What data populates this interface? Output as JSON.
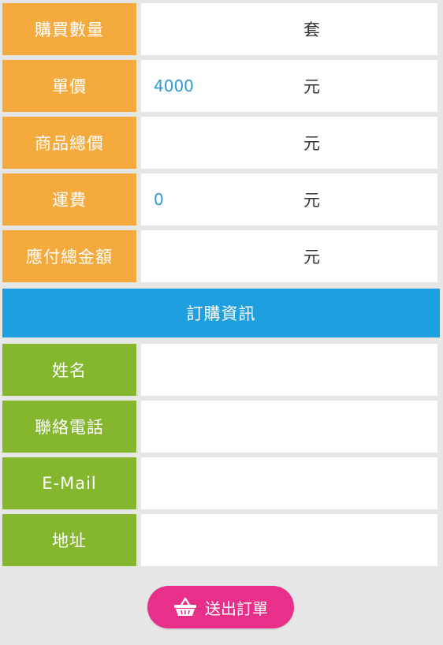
{
  "colors": {
    "order_label_bg": "#f4aa3c",
    "info_label_bg": "#84b72e",
    "section_bg": "#1ea0e0",
    "value_text": "#2b9bd3",
    "submit_bg": "#e8308a"
  },
  "order": {
    "quantity": {
      "label": "購買數量",
      "value": "",
      "unit": "套"
    },
    "unit_price": {
      "label": "單價",
      "value": "4000",
      "unit": "元"
    },
    "subtotal": {
      "label": "商品總價",
      "value": "",
      "unit": "元"
    },
    "shipping": {
      "label": "運費",
      "value": "0",
      "unit": "元"
    },
    "total": {
      "label": "應付總金額",
      "value": "",
      "unit": "元"
    }
  },
  "section_title": "訂購資訊",
  "customer": {
    "name": {
      "label": "姓名",
      "value": ""
    },
    "phone": {
      "label": "聯絡電話",
      "value": ""
    },
    "email": {
      "label": "E-Mail",
      "value": ""
    },
    "address": {
      "label": "地址",
      "value": ""
    }
  },
  "submit": {
    "label": "送出訂單",
    "icon": "basket-icon"
  }
}
